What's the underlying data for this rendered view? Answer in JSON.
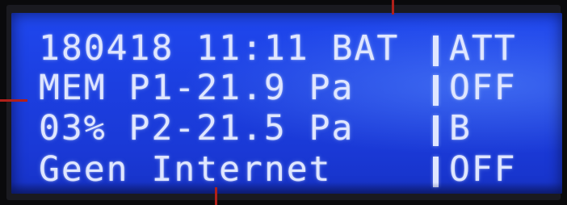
{
  "display": {
    "lines": [
      {
        "left": "180418 11:11 BAT",
        "right": "ATT"
      },
      {
        "left": "MEM P1-21.9 Pa",
        "right": "OFF"
      },
      {
        "left": "03% P2-21.5 Pa",
        "right": "B"
      },
      {
        "left": "Geen Internet",
        "right": "OFF"
      }
    ]
  },
  "colors": {
    "lcd_background": "#1c3fe0",
    "pixel_text": "#dfe6ff",
    "leader_line": "#b0201a"
  }
}
